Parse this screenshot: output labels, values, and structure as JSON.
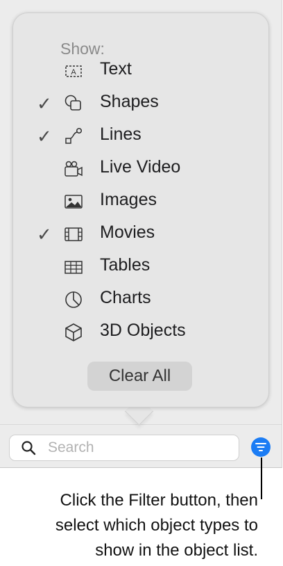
{
  "popover": {
    "header": "Show:",
    "items": [
      {
        "label": "Text",
        "checked": false,
        "icon": "text-box-icon"
      },
      {
        "label": "Shapes",
        "checked": true,
        "icon": "shapes-icon"
      },
      {
        "label": "Lines",
        "checked": true,
        "icon": "lines-icon"
      },
      {
        "label": "Live Video",
        "checked": false,
        "icon": "live-video-icon"
      },
      {
        "label": "Images",
        "checked": false,
        "icon": "image-icon"
      },
      {
        "label": "Movies",
        "checked": true,
        "icon": "film-icon"
      },
      {
        "label": "Tables",
        "checked": false,
        "icon": "table-icon"
      },
      {
        "label": "Charts",
        "checked": false,
        "icon": "chart-icon"
      },
      {
        "label": "3D Objects",
        "checked": false,
        "icon": "cube-icon"
      }
    ],
    "check_glyph": "✓",
    "clear_all_label": "Clear All"
  },
  "search": {
    "placeholder": "Search",
    "icon": "search-icon"
  },
  "filter_button": {
    "icon": "filter-icon",
    "color": "#1b7cf4"
  },
  "caption": {
    "line1": "Click the Filter button, then",
    "line2": "select which object types to",
    "line3": "show in the object list."
  }
}
